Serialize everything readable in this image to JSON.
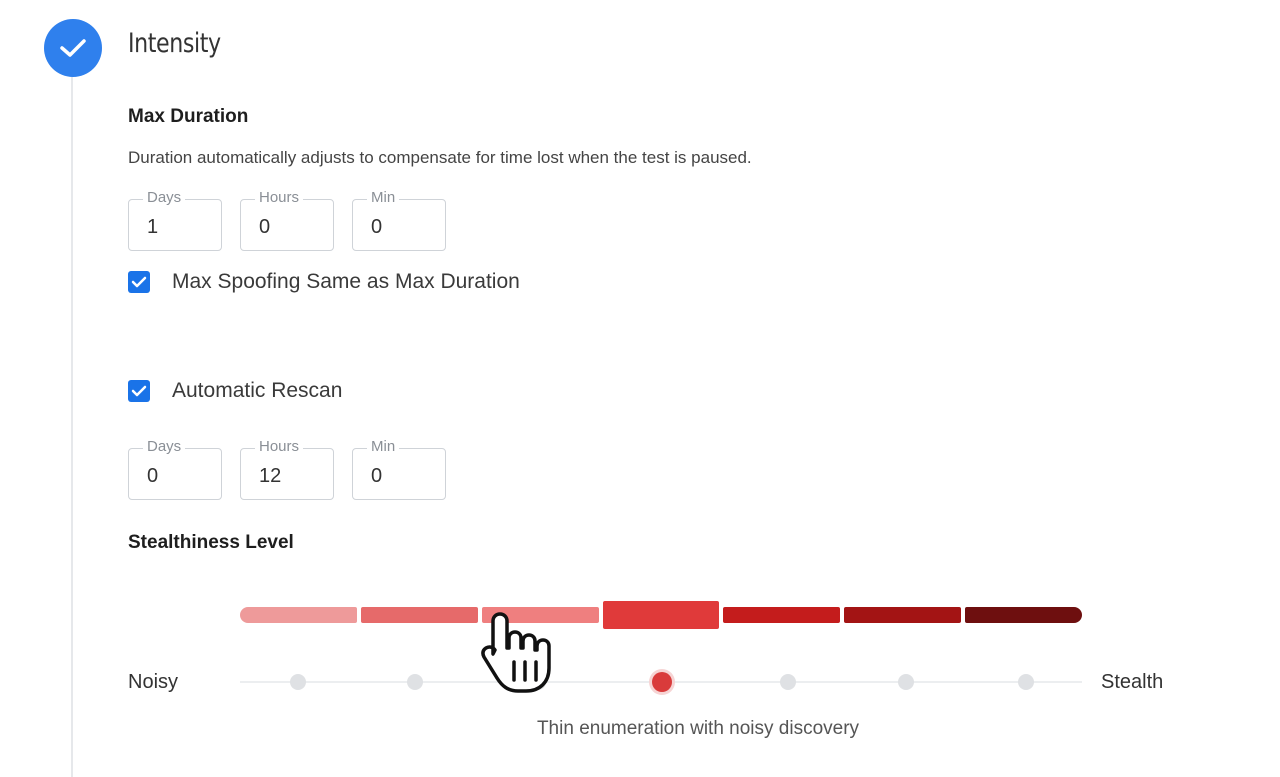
{
  "step": {
    "title": "Intensity",
    "completed": true,
    "accent_color": "#2f80ed",
    "icon": "check-icon"
  },
  "max_duration": {
    "label": "Max Duration",
    "description": "Duration automatically adjusts to compensate for time lost when the test is paused.",
    "fields": [
      {
        "label": "Days",
        "value": "1"
      },
      {
        "label": "Hours",
        "value": "0"
      },
      {
        "label": "Min",
        "value": "0"
      }
    ]
  },
  "spoofing_checkbox": {
    "label": "Max Spoofing Same as Max Duration",
    "checked": true
  },
  "rescan_checkbox": {
    "label": "Automatic Rescan",
    "checked": true
  },
  "rescan": {
    "fields": [
      {
        "label": "Days",
        "value": "0"
      },
      {
        "label": "Hours",
        "value": "12"
      },
      {
        "label": "Min",
        "value": "0"
      }
    ]
  },
  "stealthiness": {
    "label": "Stealthiness Level",
    "min_label": "Noisy",
    "max_label": "Stealth",
    "levels": 7,
    "selected_level": 4,
    "segment_colors": [
      "#ee9a9a",
      "#e66a6a",
      "#ef7f7f",
      "#e03a3a",
      "#c41c1c",
      "#a31414",
      "#6e0f0f"
    ],
    "caption": "Thin enumeration with noisy discovery"
  },
  "cursor": "hand-pointer-icon"
}
